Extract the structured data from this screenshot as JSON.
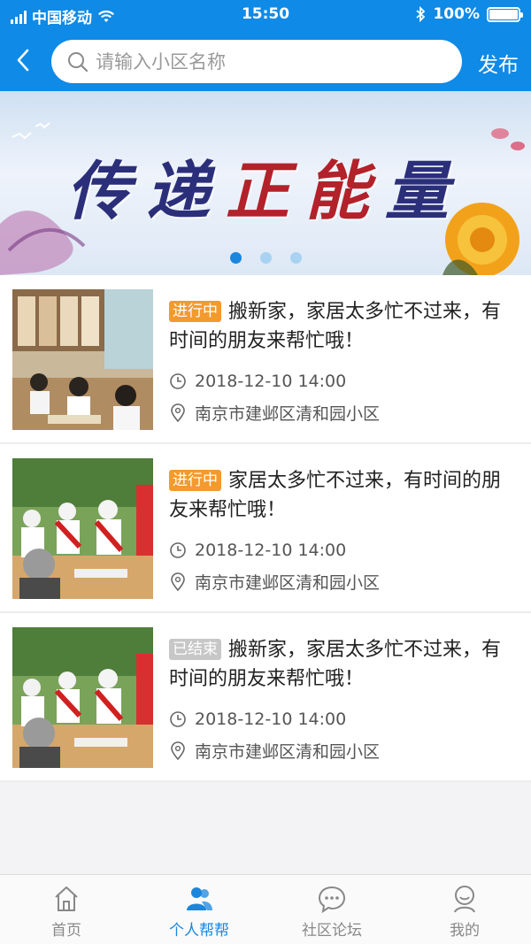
{
  "status_bar": {
    "carrier": "中国移动",
    "time": "15:50",
    "battery": "100%",
    "battery_level": 1.0
  },
  "header": {
    "search_placeholder": "请输入小区名称",
    "publish_label": "发布"
  },
  "banner": {
    "title_part1": "传递",
    "title_part2": "正能",
    "title_part3": "量",
    "slide_count": 3,
    "active_slide": 1
  },
  "list": {
    "items": [
      {
        "status": "进行中",
        "status_type": "ongoing",
        "title": "搬新家，家居太多忙不过来，有时间的朋友来帮忙哦！",
        "time": "2018-12-10 14:00",
        "address": "南京市建邺区清和园小区",
        "image": "library-students-photo"
      },
      {
        "status": "进行中",
        "status_type": "ongoing",
        "title": "家居太多忙不过来，有时间的朋友来帮忙哦！",
        "time": "2018-12-10 14:00",
        "address": "南京市建邺区清和园小区",
        "image": "volunteers-elderly-photo"
      },
      {
        "status": "已结束",
        "status_type": "ended",
        "title": "搬新家，家居太多忙不过来，有时间的朋友来帮忙哦！",
        "time": "2018-12-10 14:00",
        "address": "南京市建邺区清和园小区",
        "image": "volunteers-elderly-photo"
      }
    ]
  },
  "tabbar": {
    "tabs": [
      {
        "label": "首页",
        "icon": "home-icon",
        "active": false
      },
      {
        "label": "个人帮帮",
        "icon": "people-icon",
        "active": true
      },
      {
        "label": "社区论坛",
        "icon": "chat-icon",
        "active": false
      },
      {
        "label": "我的",
        "icon": "profile-icon",
        "active": false
      }
    ]
  },
  "colors": {
    "primary": "#0f8ae6",
    "ongoing_badge": "#f29a2e",
    "ended_badge": "#c7c7c7",
    "tab_active": "#1a86dd"
  }
}
